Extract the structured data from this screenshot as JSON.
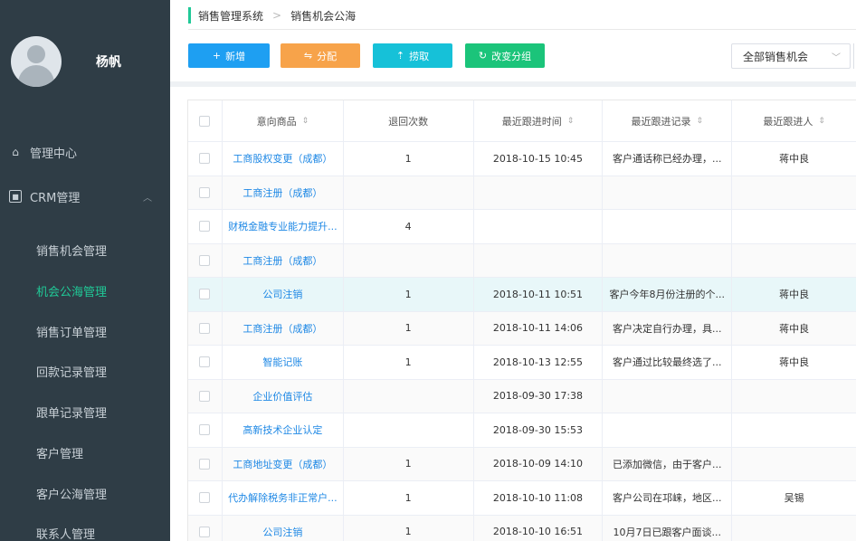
{
  "sidebar": {
    "username": "杨帆",
    "nav": [
      {
        "label": "管理中心",
        "icon": "home-icon"
      },
      {
        "label": "CRM管理",
        "icon": "crm-box-icon",
        "expanded": true
      }
    ],
    "sub_items": [
      {
        "label": "销售机会管理",
        "active": false
      },
      {
        "label": "机会公海管理",
        "active": true
      },
      {
        "label": "销售订单管理",
        "active": false
      },
      {
        "label": "回款记录管理",
        "active": false
      },
      {
        "label": "跟单记录管理",
        "active": false
      },
      {
        "label": "客户管理",
        "active": false
      },
      {
        "label": "客户公海管理",
        "active": false
      },
      {
        "label": "联系人管理",
        "active": false
      }
    ],
    "active_color": "#20c997"
  },
  "breadcrumb": {
    "root": "销售管理系统",
    "current": "销售机会公海"
  },
  "toolbar": {
    "add_label": "新增",
    "assign_label": "分配",
    "pick_label": "捞取",
    "change_group_label": "改变分组",
    "filter_value": "全部销售机会"
  },
  "table": {
    "headers": [
      "意向商品",
      "退回次数",
      "最近跟进时间",
      "最近跟进记录",
      "最近跟进人"
    ],
    "rows": [
      {
        "product": "工商股权变更（成都）",
        "returns": "1",
        "time": "2018-10-15 10:45",
        "record": "客户通话称已经办理，...",
        "person": "蒋中良"
      },
      {
        "product": "工商注册（成都）",
        "returns": "",
        "time": "",
        "record": "",
        "person": ""
      },
      {
        "product": "财税金融专业能力提升...",
        "returns": "4",
        "time": "",
        "record": "",
        "person": ""
      },
      {
        "product": "工商注册（成都）",
        "returns": "",
        "time": "",
        "record": "",
        "person": ""
      },
      {
        "product": "公司注销",
        "returns": "1",
        "time": "2018-10-11 10:51",
        "record": "客户今年8月份注册的个...",
        "person": "蒋中良"
      },
      {
        "product": "工商注册（成都）",
        "returns": "1",
        "time": "2018-10-11 14:06",
        "record": "客户决定自行办理，具...",
        "person": "蒋中良"
      },
      {
        "product": "智能记账",
        "returns": "1",
        "time": "2018-10-13 12:55",
        "record": "客户通过比较最终选了...",
        "person": "蒋中良"
      },
      {
        "product": "企业价值评估",
        "returns": "",
        "time": "2018-09-30 17:38",
        "record": "",
        "person": ""
      },
      {
        "product": "高新技术企业认定",
        "returns": "",
        "time": "2018-09-30 15:53",
        "record": "",
        "person": ""
      },
      {
        "product": "工商地址变更（成都）",
        "returns": "1",
        "time": "2018-10-09 14:10",
        "record": "已添加微信，由于客户...",
        "person": ""
      },
      {
        "product": "代办解除税务非正常户...",
        "returns": "1",
        "time": "2018-10-10 11:08",
        "record": "客户公司在邛崃，地区...",
        "person": "吴锡"
      },
      {
        "product": "公司注销",
        "returns": "1",
        "time": "2018-10-10 16:51",
        "record": "10月7日已跟客户面谈...",
        "person": ""
      }
    ],
    "highlight_row": 4,
    "link_color": "#1e88e5"
  }
}
